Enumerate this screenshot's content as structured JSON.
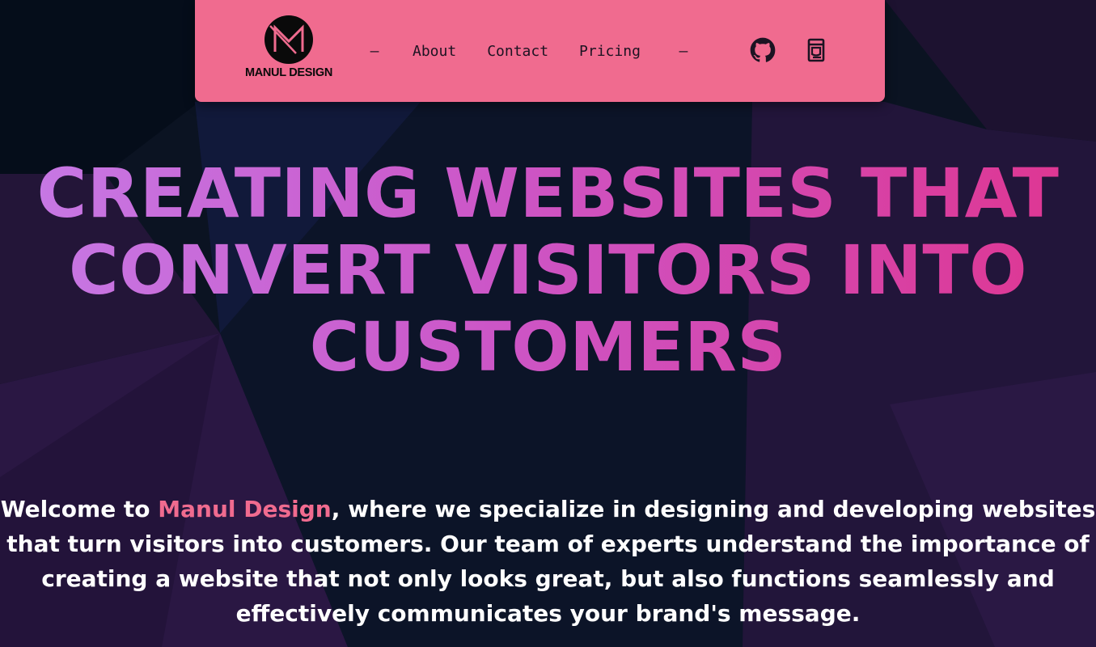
{
  "nav": {
    "logo_text": "MANUL DESIGN",
    "dash_left": "–",
    "dash_right": "–",
    "links": [
      "About",
      "Contact",
      "Pricing"
    ],
    "icons": [
      "github-icon",
      "coffee-icon"
    ]
  },
  "hero": {
    "headline_lines": [
      "CREATING WEBSITES THAT",
      "CONVERT VISITORS INTO",
      "CUSTOMERS"
    ],
    "intro_prefix": "Welcome to ",
    "intro_brand": "Manul Design",
    "intro_rest": ", where we specialize in designing and developing websites that turn visitors into customers. Our team of experts understand the importance of creating a website that not only looks great, but also functions seamlessly and effectively communicates your brand's message."
  },
  "colors": {
    "navbar": "#f06b8f",
    "brand_highlight": "#f06b8f",
    "headline_gradient_start": "#c67ae6",
    "headline_gradient_end": "#df3590",
    "background": "#0b1322",
    "text": "#ffffff"
  }
}
